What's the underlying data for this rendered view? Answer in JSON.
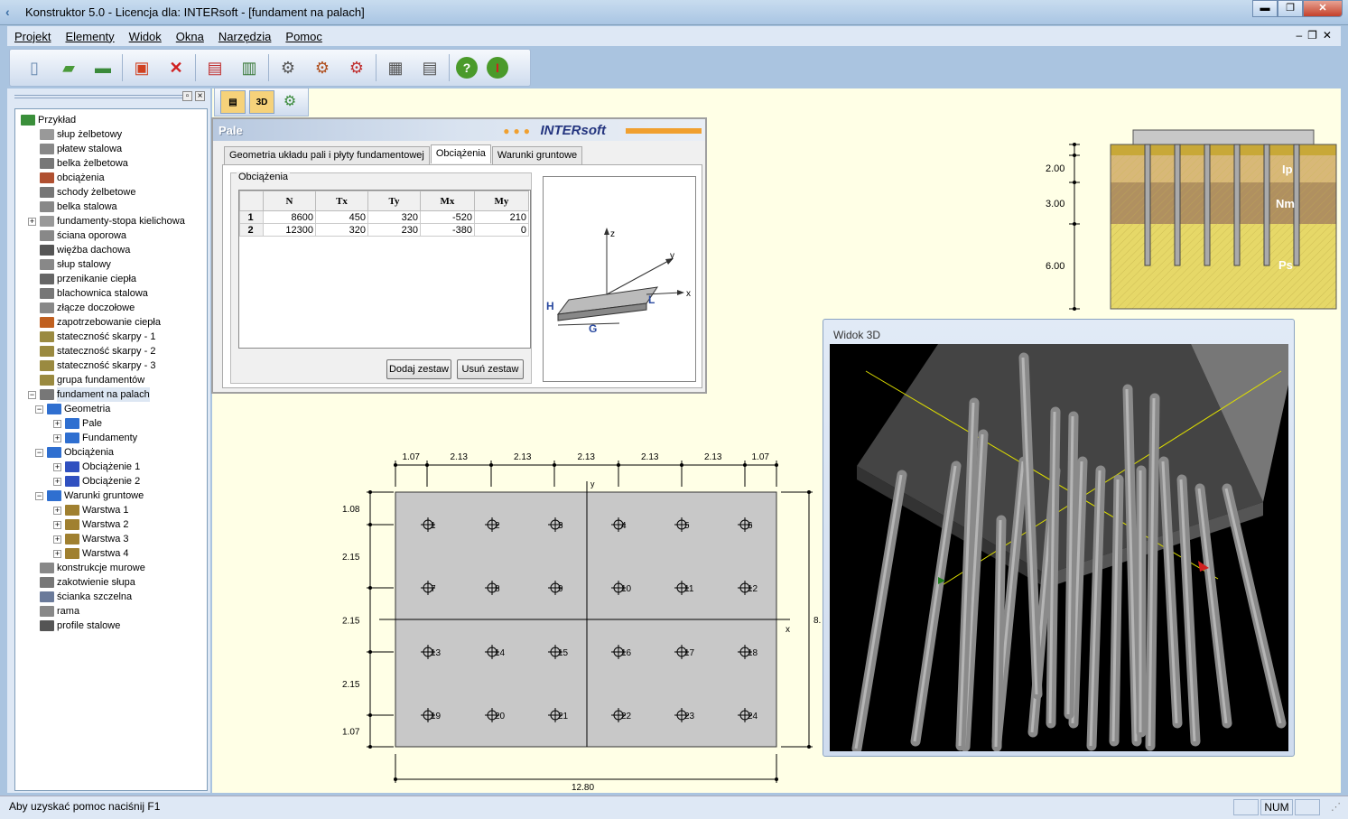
{
  "window": {
    "title": "Konstruktor 5.0 - Licencja dla: INTERsoft - [fundament na palach]"
  },
  "menu": [
    "Projekt",
    "Elementy",
    "Widok",
    "Okna",
    "Narzędzia",
    "Pomoc"
  ],
  "tree": [
    {
      "label": "Przykład",
      "level": 0,
      "icon": "folder-icon",
      "color": "#3a8f3a"
    },
    {
      "label": "słup żelbetowy",
      "level": 1,
      "icon": "column-icon",
      "color": "#999999"
    },
    {
      "label": "płatew stalowa",
      "level": 1,
      "icon": "purlin-icon",
      "color": "#888888"
    },
    {
      "label": "belka żelbetowa",
      "level": 1,
      "icon": "beam-icon",
      "color": "#777777"
    },
    {
      "label": "obciążenia",
      "level": 1,
      "icon": "load-icon",
      "color": "#b05030"
    },
    {
      "label": "schody żelbetowe",
      "level": 1,
      "icon": "stairs-icon",
      "color": "#777777"
    },
    {
      "label": "belka stalowa",
      "level": 1,
      "icon": "steel-beam-icon",
      "color": "#888888"
    },
    {
      "label": "fundamenty-stopa kielichowa",
      "level": 1,
      "icon": "foundation-icon",
      "color": "#999999",
      "expand": "+"
    },
    {
      "label": "ściana oporowa",
      "level": 1,
      "icon": "retaining-wall-icon",
      "color": "#888888"
    },
    {
      "label": "więźba dachowa",
      "level": 1,
      "icon": "roof-truss-icon",
      "color": "#555555"
    },
    {
      "label": "słup stalowy",
      "level": 1,
      "icon": "steel-column-icon",
      "color": "#888888"
    },
    {
      "label": "przenikanie ciepła",
      "level": 1,
      "icon": "heat-transfer-icon",
      "color": "#666666"
    },
    {
      "label": "blachownica stalowa",
      "level": 1,
      "icon": "plate-girder-icon",
      "color": "#777777"
    },
    {
      "label": "złącze doczołowe",
      "level": 1,
      "icon": "joint-icon",
      "color": "#888888"
    },
    {
      "label": "zapotrzebowanie ciepła",
      "level": 1,
      "icon": "heat-demand-icon",
      "color": "#c06020"
    },
    {
      "label": "stateczność skarpy - 1",
      "level": 1,
      "icon": "slope-icon",
      "color": "#9a8a40"
    },
    {
      "label": "stateczność skarpy - 2",
      "level": 1,
      "icon": "slope-icon",
      "color": "#9a8a40"
    },
    {
      "label": "stateczność skarpy - 3",
      "level": 1,
      "icon": "slope-icon",
      "color": "#9a8a40"
    },
    {
      "label": "grupa fundamentów",
      "level": 1,
      "icon": "foundation-group-icon",
      "color": "#9a8a40"
    },
    {
      "label": "fundament na palach",
      "level": 1,
      "icon": "pile-foundation-icon",
      "color": "#777777",
      "expand": "−",
      "selected": true
    },
    {
      "label": "Geometria",
      "level": 2,
      "icon": "folder-icon",
      "color": "#2f6fd0",
      "expand": "−"
    },
    {
      "label": "Pale",
      "level": 3,
      "icon": "folder-icon",
      "color": "#2f6fd0",
      "expand": "+"
    },
    {
      "label": "Fundamenty",
      "level": 3,
      "icon": "folder-icon",
      "color": "#2f6fd0",
      "expand": "+"
    },
    {
      "label": "Obciążenia",
      "level": 2,
      "icon": "folder-icon",
      "color": "#2f6fd0",
      "expand": "−"
    },
    {
      "label": "Obciążenie 1",
      "level": 3,
      "icon": "load-set-icon",
      "color": "#3050c0",
      "expand": "+"
    },
    {
      "label": "Obciążenie 2",
      "level": 3,
      "icon": "load-set-icon",
      "color": "#3050c0",
      "expand": "+"
    },
    {
      "label": "Warunki gruntowe",
      "level": 2,
      "icon": "folder-icon",
      "color": "#2f6fd0",
      "expand": "−"
    },
    {
      "label": "Warstwa 1",
      "level": 3,
      "icon": "soil-layer-icon",
      "color": "#a08030",
      "expand": "+"
    },
    {
      "label": "Warstwa 2",
      "level": 3,
      "icon": "soil-layer-icon",
      "color": "#a08030",
      "expand": "+"
    },
    {
      "label": "Warstwa 3",
      "level": 3,
      "icon": "soil-layer-icon",
      "color": "#a08030",
      "expand": "+"
    },
    {
      "label": "Warstwa 4",
      "level": 3,
      "icon": "soil-layer-icon",
      "color": "#a08030",
      "expand": "+"
    },
    {
      "label": "konstrukcje murowe",
      "level": 1,
      "icon": "masonry-icon",
      "color": "#888888"
    },
    {
      "label": "zakotwienie słupa",
      "level": 1,
      "icon": "anchor-icon",
      "color": "#777777"
    },
    {
      "label": "ścianka szczelna",
      "level": 1,
      "icon": "sheet-pile-icon",
      "color": "#6a7a9a"
    },
    {
      "label": "rama",
      "level": 1,
      "icon": "frame-icon",
      "color": "#888888"
    },
    {
      "label": "profile stalowe",
      "level": 1,
      "icon": "steel-profile-icon",
      "color": "#555555"
    }
  ],
  "dialog": {
    "title": "Pale",
    "brand": "INTERsoft",
    "tabs": [
      "Geometria układu pali i płyty fundamentowej",
      "Obciążenia",
      "Warunki gruntowe"
    ],
    "active_tab": 1,
    "group_label": "Obciążenia",
    "table": {
      "columns": [
        "N",
        "Tx",
        "Ty",
        "Mx",
        "My"
      ],
      "rows": [
        {
          "id": "1",
          "values": [
            "8600",
            "450",
            "320",
            "-520",
            "210"
          ]
        },
        {
          "id": "2",
          "values": [
            "12300",
            "320",
            "230",
            "-380",
            "0"
          ]
        }
      ]
    },
    "buttons": {
      "add": "Dodaj zestaw",
      "remove": "Usuń zestaw"
    },
    "axes": {
      "z": "z",
      "y": "y",
      "x": "x",
      "H": "H",
      "G": "G",
      "L": "L"
    }
  },
  "soil_profile": {
    "depths": [
      "2.00",
      "3.00",
      "6.00"
    ],
    "layers": [
      {
        "name": "Ip",
        "color": "#d8b878"
      },
      {
        "name": "Nm",
        "color": "#b09060"
      },
      {
        "name": "Ps",
        "color": "#e6d868"
      }
    ]
  },
  "plan": {
    "top_dims": [
      "1.07",
      "2.13",
      "2.13",
      "2.13",
      "2.13",
      "2.13",
      "1.07"
    ],
    "left_dims": [
      "1.08",
      "2.15",
      "2.15",
      "2.15",
      "1.07"
    ],
    "bottom_dim": "12.80",
    "right_dim": "8.",
    "axis_x": "x",
    "axis_y": "y",
    "piles": [
      "1",
      "2",
      "3",
      "4",
      "5",
      "6",
      "7",
      "8",
      "9",
      "10",
      "11",
      "12",
      "13",
      "14",
      "15",
      "16",
      "17",
      "18",
      "19",
      "20",
      "21",
      "22",
      "23",
      "24"
    ]
  },
  "view3d": {
    "title": "Widok 3D"
  },
  "status": {
    "text": "Aby uzyskać pomoc naciśnij F1",
    "num": "NUM"
  }
}
